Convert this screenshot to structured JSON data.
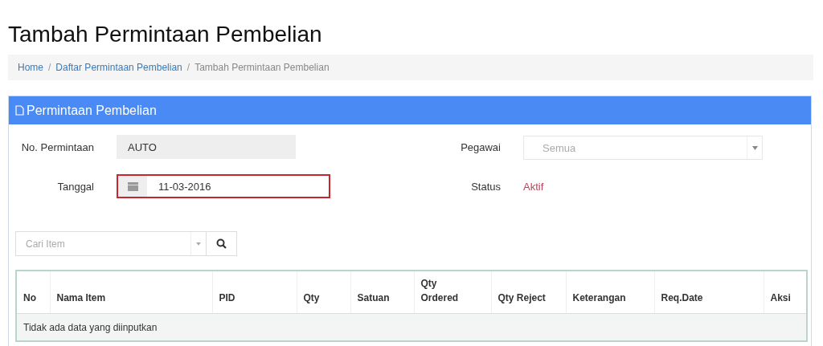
{
  "page_title": "Tambah Permintaan Pembelian",
  "breadcrumb_separator": "/",
  "breadcrumb": [
    {
      "label": "Home",
      "kind": "link"
    },
    {
      "label": "Daftar Permintaan Pembelian",
      "kind": "link"
    },
    {
      "label": "Tambah Permintaan Pembelian",
      "kind": "current"
    }
  ],
  "panel": {
    "title": "Permintaan Pembelian",
    "no_permintaan": {
      "label": "No. Permintaan",
      "value": "AUTO"
    },
    "pegawai": {
      "label": "Pegawai",
      "placeholder": "Semua"
    },
    "tanggal": {
      "label": "Tanggal",
      "value": "11-03-2016"
    },
    "status": {
      "label": "Status",
      "value": "Aktif"
    },
    "search": {
      "placeholder": "Cari Item"
    },
    "table": {
      "columns": [
        "No",
        "Nama Item",
        "PID",
        "Qty",
        "Satuan",
        "Qty Ordered",
        "Qty Reject",
        "Keterangan",
        "Req.Date",
        "Aksi"
      ],
      "empty_text": "Tidak ada data yang diinputkan"
    }
  }
}
